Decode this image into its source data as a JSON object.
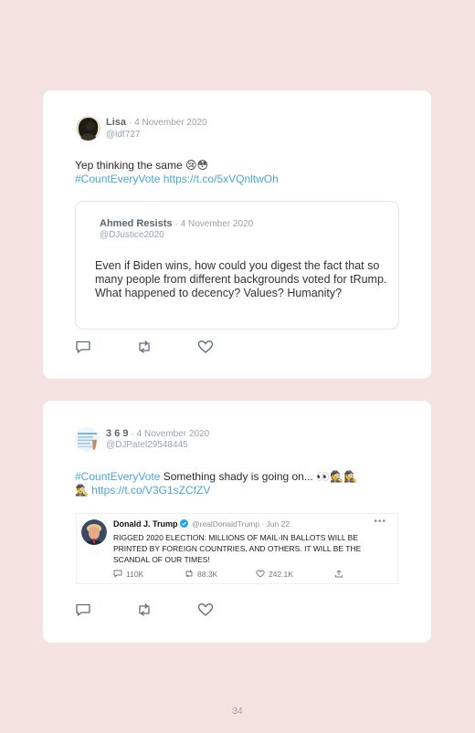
{
  "tweets": [
    {
      "author": "Lisa",
      "date": "· 4 November 2020",
      "handle": "@ldf727",
      "text": "Yep thinking the same 😢😳",
      "hashtag": "#CountEveryVote",
      "link": "https://t.co/5xVQnltwOh",
      "quote": {
        "author": "Ahmed Resists",
        "date": "· 4 November 2020",
        "handle": "@DJustice2020",
        "text": "Even if Biden wins, how could you digest the fact that so many people from different backgrounds voted for tRump. What happened to decency? Values? Humanity?"
      }
    },
    {
      "author": "3 6 9",
      "date": "· 4 November 2020",
      "handle": "@DJPatel29548445",
      "hashtag": "#CountEveryVote",
      "text_line1": " Something shady is going on... 👀🕵️🕵️‍♀️",
      "text_line2_prefix": "🕵️‍♂️",
      "link": "https://t.co/V3G1sZCfZV",
      "embed": {
        "name": "Donald J. Trump",
        "handle": "@realDonaldTrump · Jun 22",
        "more": "•••",
        "text": "RIGGED 2020 ELECTION: MILLIONS OF MAIL-IN BALLOTS WILL BE PRINTED BY FOREIGN COUNTRIES, AND OTHERS. IT WILL BE THE SCANDAL OF OUR TIMES!",
        "replies": "110K",
        "retweets": "88.3K",
        "likes": "242.1K"
      }
    }
  ],
  "icons": {
    "reply": "reply-icon",
    "retweet": "retweet-icon",
    "like": "heart-icon",
    "share": "share-icon",
    "verified": "verified-badge-icon"
  },
  "colors": {
    "link": "#4aa6d9",
    "background": "#f5e3e2",
    "verified": "#1da1f2"
  },
  "page_number": "34"
}
